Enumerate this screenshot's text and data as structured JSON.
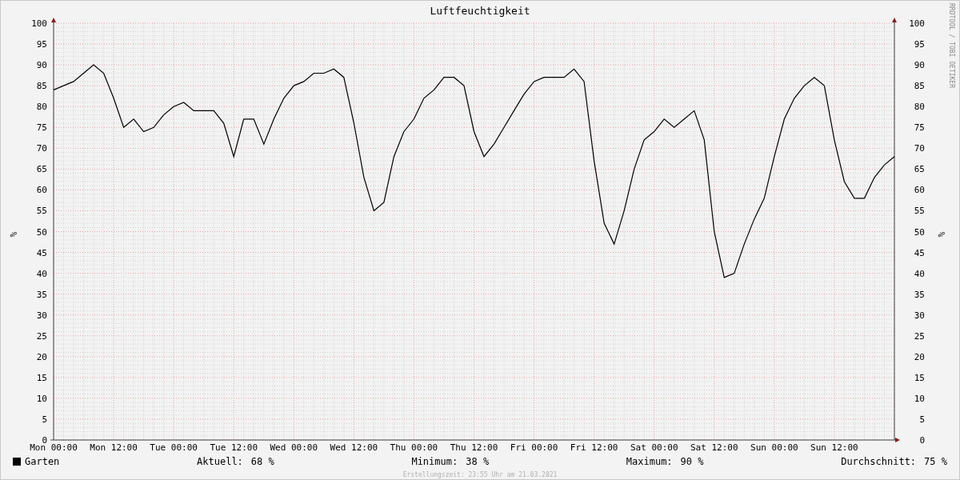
{
  "title": "Luftfeuchtigkeit",
  "signature": "RRDTOOL / TOBI OETIKER",
  "chart": {
    "chart_data": {
      "type": "line",
      "grid": true,
      "ylabel": "%",
      "ylim": [
        0,
        100
      ],
      "categories": [
        "Mon 00:00",
        null,
        null,
        null,
        null,
        null,
        "Mon 12:00",
        null,
        null,
        null,
        null,
        null,
        "Tue 00:00",
        null,
        null,
        null,
        null,
        null,
        "Tue 12:00",
        null,
        null,
        null,
        null,
        null,
        "Wed 00:00",
        null,
        null,
        null,
        null,
        null,
        "Wed 12:00",
        null,
        null,
        null,
        null,
        null,
        "Thu 00:00",
        null,
        null,
        null,
        null,
        null,
        "Thu 12:00",
        null,
        null,
        null,
        null,
        null,
        "Fri 00:00",
        null,
        null,
        null,
        null,
        null,
        "Fri 12:00",
        null,
        null,
        null,
        null,
        null,
        "Sat 00:00",
        null,
        null,
        null,
        null,
        null,
        "Sat 12:00",
        null,
        null,
        null,
        null,
        null,
        "Sun 00:00",
        null,
        null,
        null,
        null,
        null,
        "Sun 12:00",
        null,
        null,
        null,
        null,
        null,
        null
      ],
      "series": [
        {
          "name": "Garten",
          "color": "#000000",
          "values": [
            84,
            85,
            86,
            88,
            90,
            88,
            82,
            75,
            77,
            74,
            75,
            78,
            80,
            81,
            79,
            79,
            79,
            76,
            68,
            77,
            77,
            71,
            77,
            82,
            85,
            86,
            88,
            88,
            89,
            87,
            76,
            63,
            55,
            57,
            68,
            74,
            77,
            82,
            84,
            87,
            87,
            85,
            74,
            68,
            71,
            75,
            79,
            83,
            86,
            87,
            87,
            87,
            89,
            86,
            67,
            52,
            47,
            55,
            65,
            72,
            74,
            77,
            75,
            77,
            79,
            72,
            50,
            39,
            40,
            47,
            53,
            58,
            68,
            77,
            82,
            85,
            87,
            85,
            72,
            62,
            58,
            58,
            63,
            66,
            68
          ]
        }
      ],
      "yticks": [
        0,
        5,
        10,
        15,
        20,
        25,
        30,
        35,
        40,
        45,
        50,
        55,
        60,
        65,
        70,
        75,
        80,
        85,
        90,
        95,
        100
      ]
    },
    "right_axis": {
      "label": "%",
      "ticks": [
        "100",
        "95",
        "90",
        "85",
        "80",
        "75",
        "70",
        "65",
        "60",
        "55",
        "50",
        "45",
        "40",
        "35",
        "30",
        "25",
        "20",
        "15",
        "10",
        "5",
        "0"
      ]
    }
  },
  "legend": {
    "stats": [
      {
        "label": "Aktuell:",
        "value": "68 %"
      },
      {
        "label": "Minimum:",
        "value": "38 %"
      },
      {
        "label": "Maximum:",
        "value": "90 %"
      },
      {
        "label": "Durchschnitt:",
        "value": "75 %"
      }
    ]
  },
  "footer": "Erstellungszeit: 23:55 Uhr am 21.03.2021"
}
